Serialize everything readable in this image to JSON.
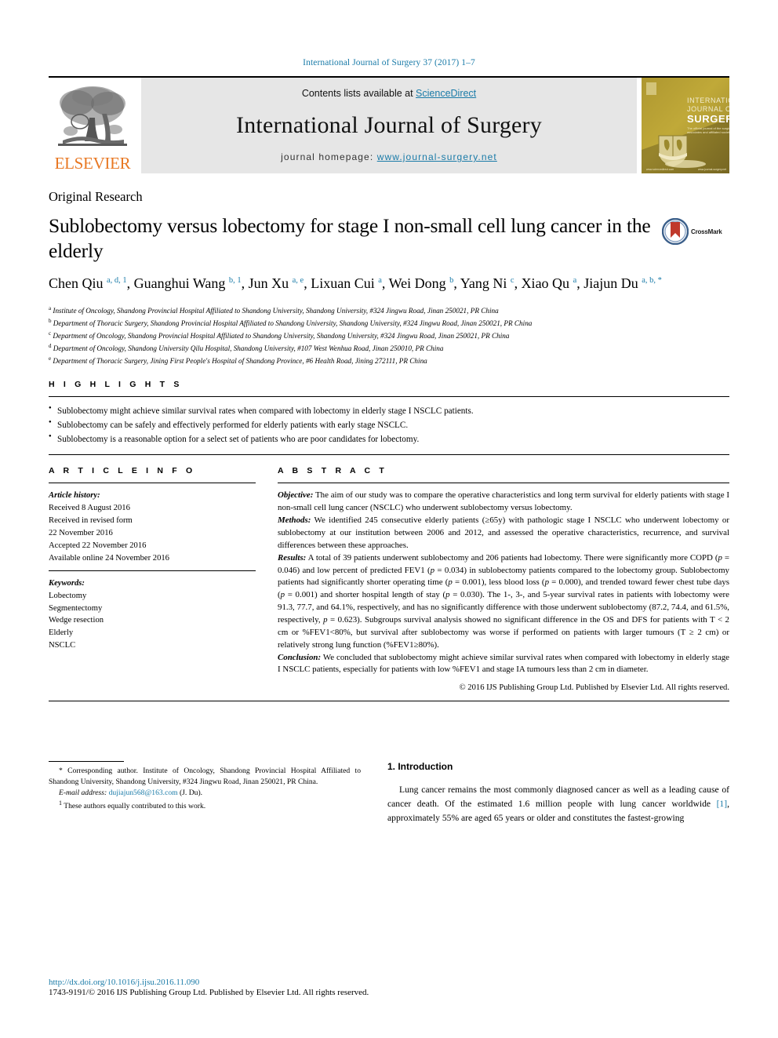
{
  "running_head": "International Journal of Surgery 37 (2017) 1–7",
  "masthead": {
    "contents_prefix": "Contents lists available at ",
    "sciencedirect": "ScienceDirect",
    "journal_title": "International Journal of Surgery",
    "homepage_label": "journal homepage: ",
    "homepage_url": "www.journal-surgery.net",
    "publisher_wordmark": "ELSEVIER",
    "publisher_icon": "elsevier-tree-icon",
    "cover_lines": [
      "INTERNATIONAL",
      "JOURNAL OF",
      "SURGERY"
    ],
    "cover_subtitle": "The official journal of the\nsurgical associates and affiliates",
    "cover_footer_left": "www.sciencedirect.com",
    "cover_footer_right": "www.journal-surgery.net",
    "accent_blue": "#1a7ba8",
    "elsevier_orange": "#e87722",
    "band_gray": "#e6e6e6"
  },
  "article": {
    "kind": "Original Research",
    "title": "Sublobectomy versus lobectomy for stage I non-small cell lung cancer in the elderly",
    "crossmark_label": "CrossMark",
    "authors_html": "Chen Qiu <sup>a, d, 1</sup>, Guanghui Wang <sup>b, 1</sup>, Jun Xu <sup>a, e</sup>, Lixuan Cui <sup>a</sup>, Wei Dong <sup>b</sup>, Yang Ni <sup>c</sup>, Xiao Qu <sup>a</sup>, Jiajun Du <sup>a, b, *</sup>",
    "affiliations": [
      {
        "mark": "a",
        "text": "Institute of Oncology, Shandong Provincial Hospital Affiliated to Shandong University, Shandong University, #324 Jingwu Road, Jinan 250021, PR China"
      },
      {
        "mark": "b",
        "text": "Department of Thoracic Surgery, Shandong Provincial Hospital Affiliated to Shandong University, Shandong University, #324 Jingwu Road, Jinan 250021, PR China"
      },
      {
        "mark": "c",
        "text": "Department of Oncology, Shandong Provincial Hospital Affiliated to Shandong University, Shandong University, #324 Jingwu Road, Jinan 250021, PR China"
      },
      {
        "mark": "d",
        "text": "Department of Oncology, Shandong University Qilu Hospital, Shandong University, #107 West Wenhua Road, Jinan 250010, PR China"
      },
      {
        "mark": "e",
        "text": "Department of Thoracic Surgery, Jining First People's Hospital of Shandong Province, #6 Health Road, Jining 272111, PR China"
      }
    ]
  },
  "highlights": {
    "heading": "H I G H L I G H T S",
    "items": [
      "Sublobectomy might achieve similar survival rates when compared with lobectomy in elderly stage I NSCLC patients.",
      "Sublobectomy can be safely and effectively performed for elderly patients with early stage NSCLC.",
      "Sublobectomy is a reasonable option for a select set of patients who are poor candidates for lobectomy."
    ]
  },
  "article_info": {
    "heading": "A R T I C L E  I N F O",
    "history_label": "Article history:",
    "history": [
      "Received 8 August 2016",
      "Received in revised form",
      "22 November 2016",
      "Accepted 22 November 2016",
      "Available online 24 November 2016"
    ],
    "keywords_label": "Keywords:",
    "keywords": [
      "Lobectomy",
      "Segmentectomy",
      "Wedge resection",
      "Elderly",
      "NSCLC"
    ]
  },
  "abstract": {
    "heading": "A B S T R A C T",
    "sections": [
      {
        "label": "Objective:",
        "text": " The aim of our study was to compare the operative characteristics and long term survival for elderly patients with stage I non-small cell lung cancer (NSCLC) who underwent sublobectomy versus lobectomy."
      },
      {
        "label": "Methods:",
        "text": " We identified 245 consecutive elderly patients (≥65y) with pathologic stage I NSCLC who underwent lobectomy or sublobectomy at our institution between 2006 and 2012, and assessed the operative characteristics, recurrence, and survival differences between these approaches."
      },
      {
        "label": "Results:",
        "text": " A total of 39 patients underwent sublobectomy and 206 patients had lobectomy. There were significantly more COPD (p = 0.046) and low percent of predicted FEV1 (p = 0.034) in sublobectomy patients compared to the lobectomy group. Sublobectomy patients had significantly shorter operating time (p = 0.001), less blood loss (p = 0.000), and trended toward fewer chest tube days (p = 0.001) and shorter hospital length of stay (p = 0.030). The 1-, 3-, and 5-year survival rates in patients with lobectomy were 91.3, 77.7, and 64.1%, respectively, and has no significantly difference with those underwent sublobectomy (87.2, 74.4, and 61.5%, respectively, p = 0.623). Subgroups survival analysis showed no significant difference in the OS and DFS for patients with T < 2 cm or %FEV1<80%, but survival after sublobectomy was worse if performed on patients with larger tumours (T ≥ 2 cm) or relatively strong lung function (%FEV1≥80%)."
      },
      {
        "label": "Conclusion:",
        "text": " We concluded that sublobectomy might achieve similar survival rates when compared with lobectomy in elderly stage I NSCLC patients, especially for patients with low %FEV1 and stage IA tumours less than 2 cm in diameter."
      }
    ],
    "copyright": "© 2016 IJS Publishing Group Ltd. Published by Elsevier Ltd. All rights reserved."
  },
  "footnotes": {
    "corresponding": "* Corresponding author. Institute of Oncology, Shandong Provincial Hospital Affiliated to Shandong University, Shandong University, #324 Jingwu Road, Jinan 250021, PR China.",
    "email_label": "E-mail address:",
    "email": "dujiajun568@163.com",
    "email_suffix": " (J. Du).",
    "equal_contrib_mark": "1",
    "equal_contrib": " These authors equally contributed to this work."
  },
  "introduction": {
    "heading": "1.  Introduction",
    "paragraph_pre": "Lung cancer remains the most commonly diagnosed cancer as well as a leading cause of cancer death. Of the estimated 1.6 million people with lung cancer worldwide ",
    "citation": "[1]",
    "paragraph_post": ", approximately 55% are aged 65 years or older and constitutes the fastest-growing"
  },
  "page_footer": {
    "doi": "http://dx.doi.org/10.1016/j.ijsu.2016.11.090",
    "issn_line": "1743-9191/© 2016 IJS Publishing Group Ltd. Published by Elsevier Ltd. All rights reserved."
  }
}
